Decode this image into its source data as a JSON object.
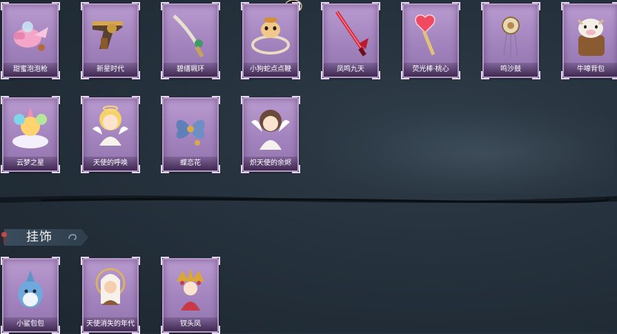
{
  "top_items": [
    {
      "label": "甜蜜泡泡枪",
      "icon": "bubble-gun-icon"
    },
    {
      "label": "新星时代",
      "icon": "revolver-icon"
    },
    {
      "label": "碧缮珮环",
      "icon": "jade-sword-icon"
    },
    {
      "label": "小狗蛇点点鞭",
      "icon": "dog-whip-icon"
    },
    {
      "label": "凤鸣九天",
      "icon": "phoenix-blade-icon"
    },
    {
      "label": "荧光棒·桃心",
      "icon": "heart-wand-icon"
    },
    {
      "label": "鸣沙鼓",
      "icon": "sand-drum-icon"
    },
    {
      "label": "牛嗥背包",
      "icon": "cow-backpack-icon"
    },
    {
      "label": "云梦之星",
      "icon": "cloud-unicorn-icon"
    },
    {
      "label": "天使的呼唤",
      "icon": "angel-doll-icon"
    },
    {
      "label": "蝶恋花",
      "icon": "butterfly-flower-icon"
    },
    {
      "label": "炽天使的余烬",
      "icon": "seraph-doll-icon"
    }
  ],
  "section": {
    "title": "挂饰"
  },
  "charm_items": [
    {
      "label": "小鲨包包",
      "icon": "shark-charm-icon"
    },
    {
      "label": "天使消失的年代",
      "icon": "veiled-angel-icon"
    },
    {
      "label": "钗头凤",
      "icon": "phoenix-crown-icon"
    }
  ],
  "badge": {
    "icon": "owl-badge-icon"
  }
}
